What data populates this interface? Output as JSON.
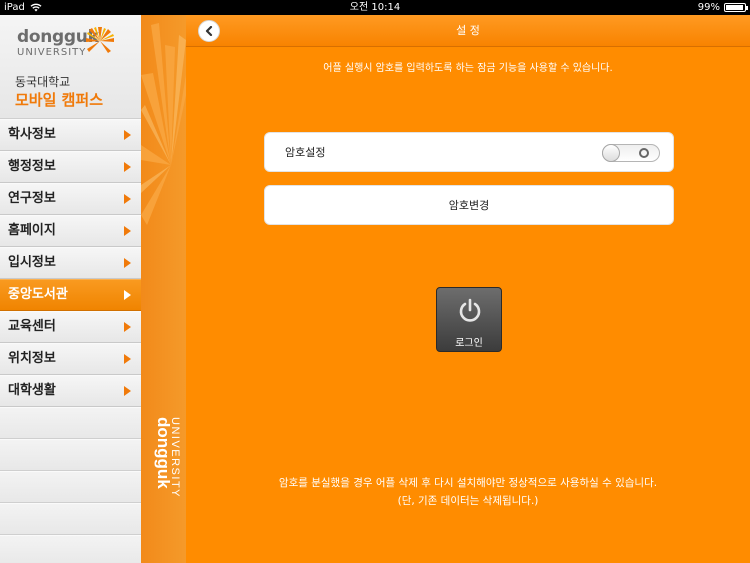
{
  "status_bar": {
    "device": "iPad",
    "time": "오전 10:14",
    "battery": "99%"
  },
  "sidebar": {
    "logo_word": "dongguk",
    "logo_univ": "UNIVERSITY",
    "campus_line1": "동국대학교",
    "campus_line2": "모바일 캠퍼스",
    "items": [
      {
        "label": "학사정보"
      },
      {
        "label": "행정정보"
      },
      {
        "label": "연구정보"
      },
      {
        "label": "홈페이지"
      },
      {
        "label": "입시정보"
      },
      {
        "label": "중앙도서관",
        "active": true
      },
      {
        "label": "교육센터"
      },
      {
        "label": "위치정보"
      },
      {
        "label": "대학생활"
      }
    ]
  },
  "deco": {
    "word": "dongguk",
    "univ": "UNIVERSITY"
  },
  "main": {
    "title": "설 정",
    "info_top": "어플 실행시 암호를 입력하도록 하는 잠금 기능을 사용할 수 있습니다.",
    "password_setting_label": "암호설정",
    "password_toggle_on": false,
    "password_change_label": "암호변경",
    "login_label": "로그인",
    "info_bottom_1": "암호를 분실했을 경우 어플 삭제 후 다시 설치해야만 정상적으로 사용하실 수 있습니다.",
    "info_bottom_2": "(단, 기존 데이터는 삭제됩니다.)"
  },
  "colors": {
    "accent": "#ff8c00",
    "sidebar_bg": "#ececec",
    "arrow": "#f07a0a"
  }
}
